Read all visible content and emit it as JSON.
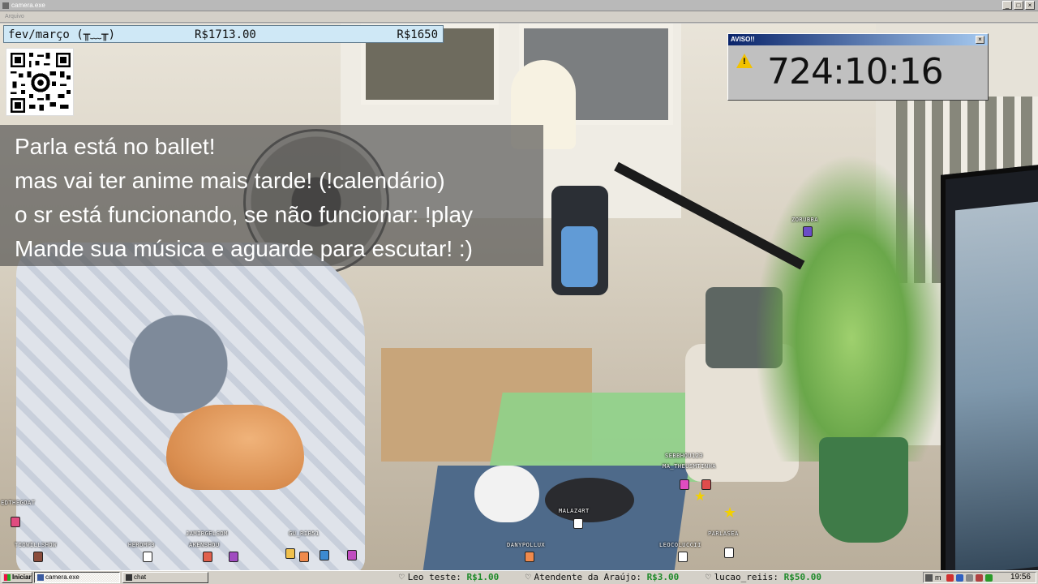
{
  "window": {
    "title": "camera.exe",
    "menu": "Arquivo",
    "controls": [
      "_",
      "□",
      "×"
    ]
  },
  "topbar": {
    "month": "fev/março (╥﹏╥)",
    "amount_raised": "R$1713.00",
    "goal": "R$1650"
  },
  "qr_code": {
    "icon": "qr-code-icon"
  },
  "message_lines": [
    "Parla está no ballet!",
    "mas vai ter anime mais tarde! (!calendário)",
    "o sr está funcionando, se não funcionar: !play",
    "Mande sua música e aguarde para escutar! :)"
  ],
  "warning_window": {
    "title": "AVISO!!",
    "close": "×",
    "icon": "warning-icon",
    "timer": "724:10:16"
  },
  "chatters": [
    {
      "name": "ZORUBBA",
      "color": "#6a4cc7"
    },
    {
      "name": "SEBBHOU123",
      "color": "#e04cc0"
    },
    {
      "name": "MA_THEUSMTINHA",
      "color": "#e04c4c"
    },
    {
      "name": "MALAZ4RT",
      "color": "#ffffff"
    },
    {
      "name": "PARLASEA",
      "color": "#ffffff"
    },
    {
      "name": "LEOCOLUCCII",
      "color": "#ffffff"
    },
    {
      "name": "DANYPOLLUX",
      "color": "#f08a4c"
    },
    {
      "name": "GU_RIB51",
      "color": "#f0c04c"
    },
    {
      "name": "JAMIRGELSOM",
      "color": "#e0604c"
    },
    {
      "name": "AKENSHOU",
      "color": "#e0604c"
    },
    {
      "name": "HEROMP3",
      "color": "#ffffff"
    },
    {
      "name": "TIOWILLSHOW",
      "color": "#8a4c3c"
    },
    {
      "name": "EDTHEGOAT",
      "color": "#e04c80"
    }
  ],
  "taskbar": {
    "start_label": "Iniciar",
    "tasks": [
      "camera.exe",
      "chat"
    ],
    "ticker": [
      {
        "name": "Leo teste:",
        "amount": "R$1.00"
      },
      {
        "name": "Atendente da Araújo:",
        "amount": "R$3.00"
      },
      {
        "name": "lucao_reiis:",
        "amount": "R$50.00"
      }
    ],
    "tray_label": "m",
    "clock": "19:56"
  }
}
